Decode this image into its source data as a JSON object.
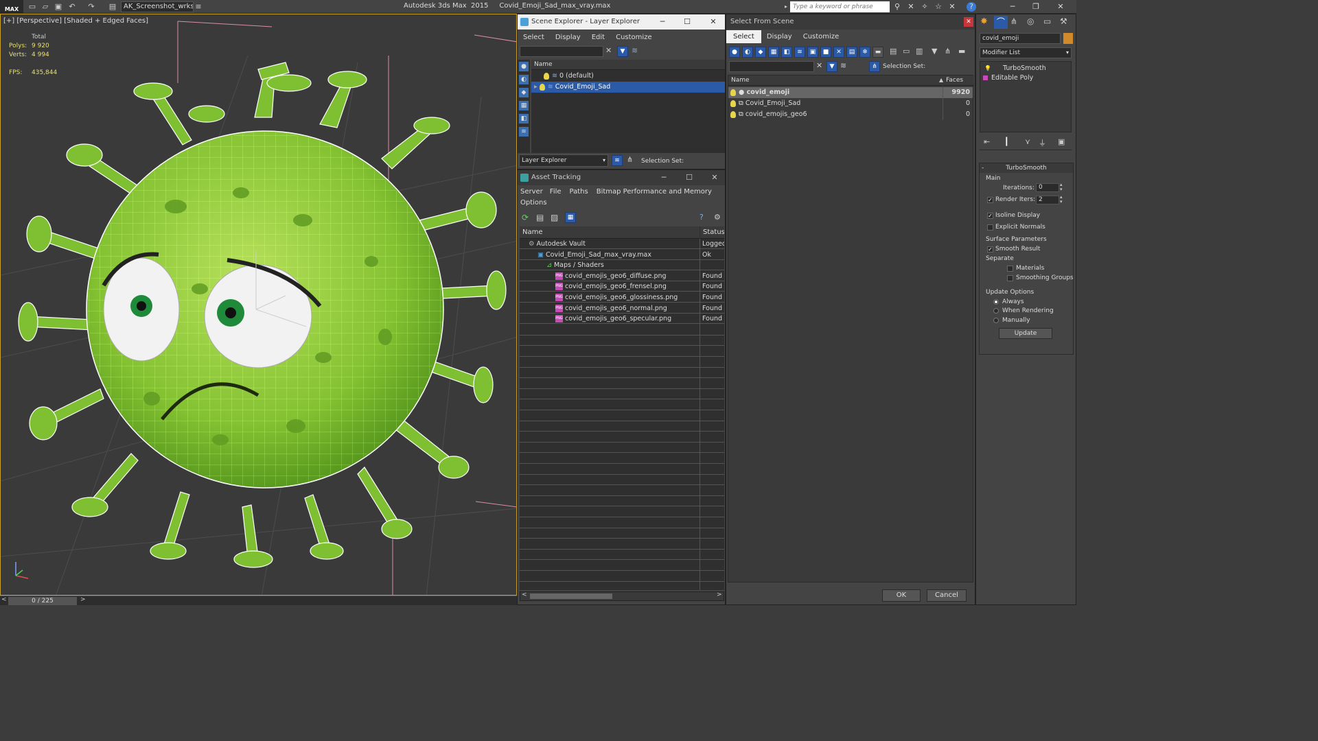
{
  "app": {
    "logo": "MAX",
    "workspace": "AK_Screenshot_wrksp",
    "title": "Autodesk 3ds Max  2015     Covid_Emoji_Sad_max_vray.max",
    "search_placeholder": "Type a keyword or phrase"
  },
  "viewport": {
    "label": "[+] [Perspective] [Shaded + Edged Faces]",
    "stats": {
      "total_label": "Total",
      "polys_label": "Polys:",
      "polys_value": "9 920",
      "verts_label": "Verts:",
      "verts_value": "4 994",
      "fps_label": "FPS:",
      "fps_value": "435,844"
    },
    "timeline": "0 / 225",
    "colors": {
      "body": "#8dc63f",
      "edges": "#ffffff",
      "bg": "#3a3a3a"
    }
  },
  "scene_explorer": {
    "title": "Scene Explorer - Layer Explorer",
    "menu": [
      "Select",
      "Display",
      "Edit",
      "Customize"
    ],
    "col_name": "Name",
    "rows": [
      {
        "label": "0 (default)",
        "selected": false
      },
      {
        "label": "Covid_Emoji_Sad",
        "selected": true
      }
    ],
    "footer_dropdown": "Layer Explorer",
    "selection_set": "Selection Set:"
  },
  "asset_tracking": {
    "title": "Asset Tracking",
    "menu": [
      "Server",
      "File",
      "Paths",
      "Bitmap Performance and Memory",
      "Options"
    ],
    "col_name": "Name",
    "col_status": "Status",
    "rows": [
      {
        "name": "Autodesk Vault",
        "status": "Logged",
        "indent": 1
      },
      {
        "name": "Covid_Emoji_Sad_max_vray.max",
        "status": "Ok",
        "indent": 2
      },
      {
        "name": "Maps / Shaders",
        "status": "",
        "indent": 3
      },
      {
        "name": "covid_emojis_geo6_diffuse.png",
        "status": "Found",
        "indent": 4
      },
      {
        "name": "covid_emojis_geo6_frensel.png",
        "status": "Found",
        "indent": 4
      },
      {
        "name": "covid_emojis_geo6_glossiness.png",
        "status": "Found",
        "indent": 4
      },
      {
        "name": "covid_emojis_geo6_normal.png",
        "status": "Found",
        "indent": 4
      },
      {
        "name": "covid_emojis_geo6_specular.png",
        "status": "Found",
        "indent": 4
      }
    ]
  },
  "select_from_scene": {
    "title": "Select From Scene",
    "menu": [
      "Select",
      "Display",
      "Customize"
    ],
    "selection_set": "Selection Set:",
    "col_name": "Name",
    "col_faces": "Faces",
    "rows": [
      {
        "name": "covid_emoji",
        "faces": "9920",
        "selected": true
      },
      {
        "name": "Covid_Emoji_Sad",
        "faces": "0",
        "selected": false
      },
      {
        "name": "covid_emojis_geo6",
        "faces": "0",
        "selected": false
      }
    ],
    "ok": "OK",
    "cancel": "Cancel"
  },
  "command_panel": {
    "object_name": "covid_emoji",
    "modifier_list": "Modifier List",
    "stack": [
      "TurboSmooth",
      "Editable Poly"
    ],
    "rollout_title": "TurboSmooth",
    "main_label": "Main",
    "iterations_label": "Iterations:",
    "iterations_value": "0",
    "render_iters_label": "Render Iters:",
    "render_iters_value": "2",
    "isoline_display": "Isoline Display",
    "explicit_normals": "Explicit Normals",
    "surface_params": "Surface Parameters",
    "smooth_result": "Smooth Result",
    "separate": "Separate",
    "materials": "Materials",
    "smoothing_groups": "Smoothing Groups",
    "update_options": "Update Options",
    "always": "Always",
    "when_rendering": "When Rendering",
    "manually": "Manually",
    "update_button": "Update"
  }
}
